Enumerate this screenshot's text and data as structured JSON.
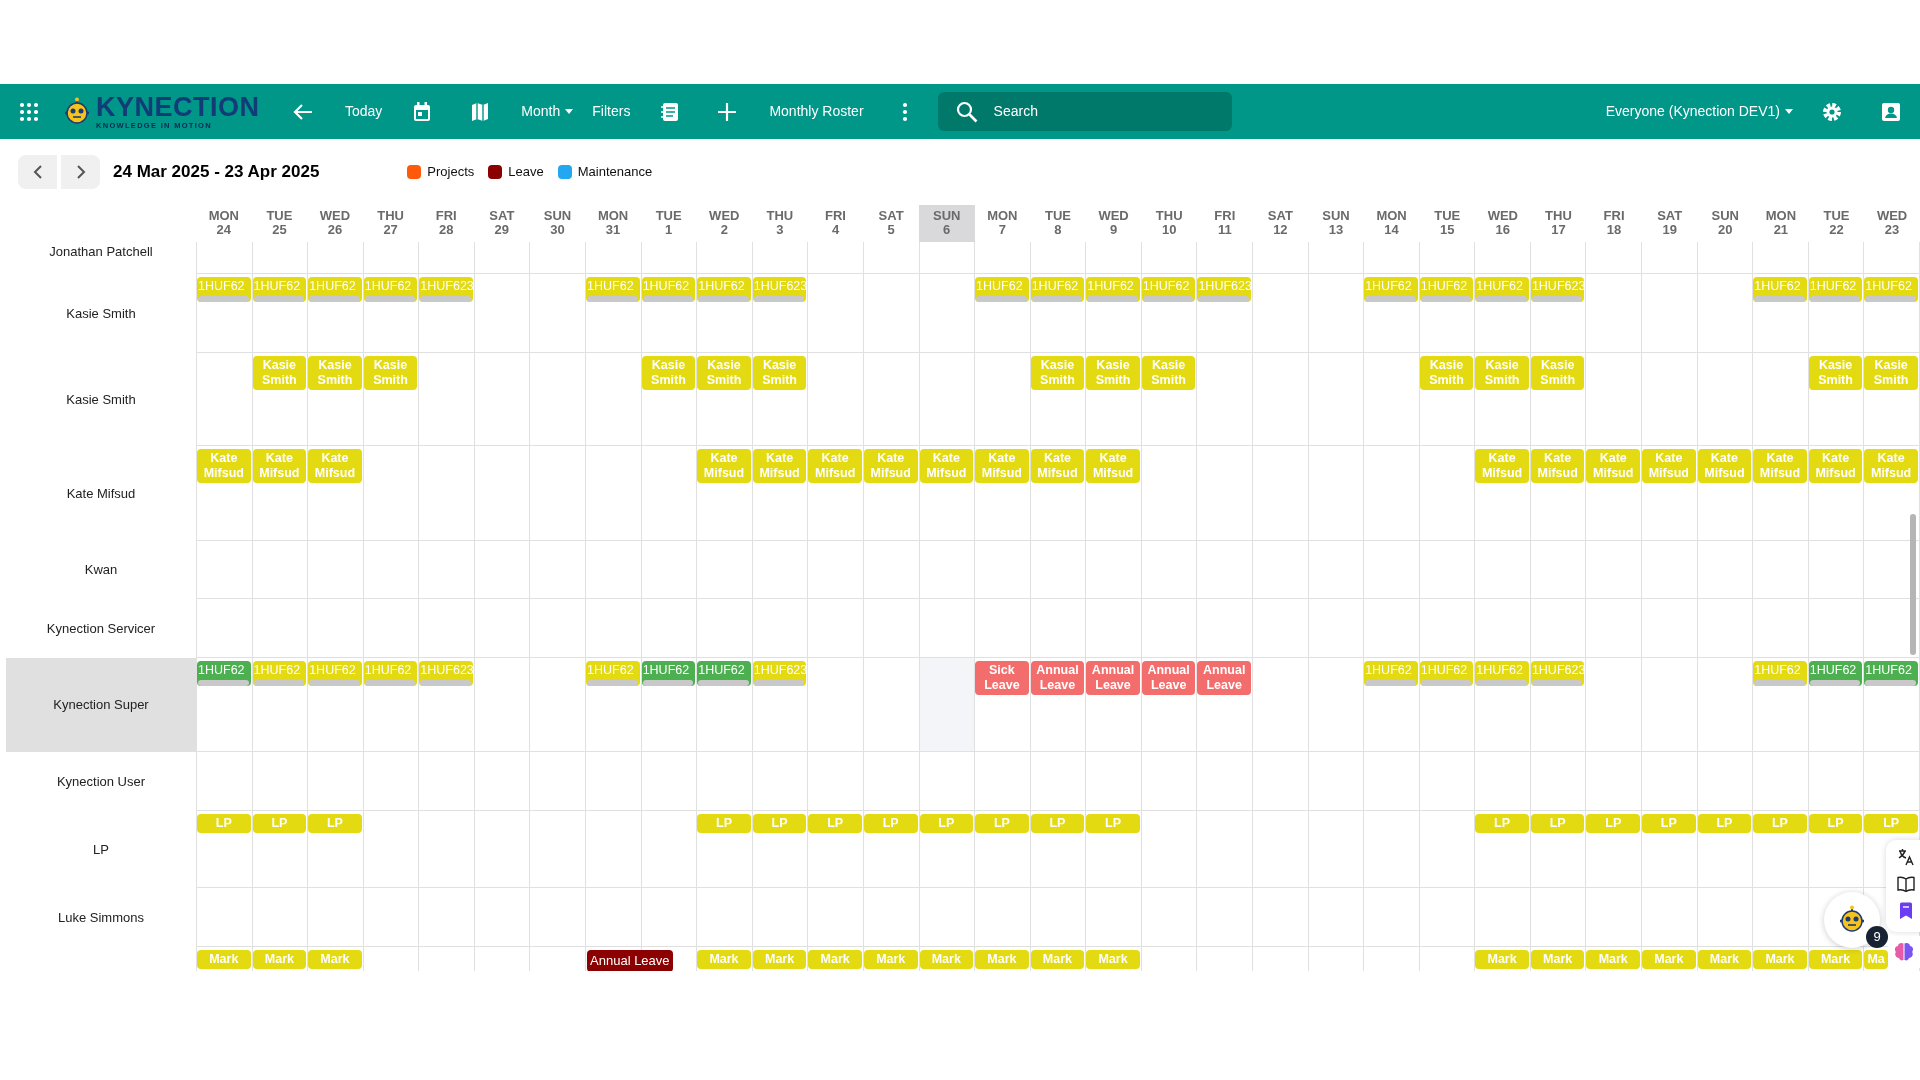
{
  "toolbar": {
    "logo": {
      "name": "KYNECTION",
      "tagline": "KNOWLEDGE IN MOTION"
    },
    "today": "Today",
    "view": "Month",
    "filters": "Filters",
    "roster": "Monthly Roster",
    "search": {
      "placeholder": "Search"
    },
    "scope": "Everyone (Kynection DEV1)"
  },
  "range": "24 Mar 2025 - 23 Apr 2025",
  "legend": [
    {
      "label": "Projects",
      "color": "#ff5a0a"
    },
    {
      "label": "Leave",
      "color": "#8b0000"
    },
    {
      "label": "Maintenance",
      "color": "#22a7f0"
    }
  ],
  "days": [
    {
      "dow": "MON",
      "date": "24",
      "selected": false
    },
    {
      "dow": "TUE",
      "date": "25",
      "selected": false
    },
    {
      "dow": "WED",
      "date": "26",
      "selected": false
    },
    {
      "dow": "THU",
      "date": "27",
      "selected": false
    },
    {
      "dow": "FRI",
      "date": "28",
      "selected": false
    },
    {
      "dow": "SAT",
      "date": "29",
      "selected": false
    },
    {
      "dow": "SUN",
      "date": "30",
      "selected": false
    },
    {
      "dow": "MON",
      "date": "31",
      "selected": false
    },
    {
      "dow": "TUE",
      "date": "1",
      "selected": false
    },
    {
      "dow": "WED",
      "date": "2",
      "selected": false
    },
    {
      "dow": "THU",
      "date": "3",
      "selected": false
    },
    {
      "dow": "FRI",
      "date": "4",
      "selected": false
    },
    {
      "dow": "SAT",
      "date": "5",
      "selected": false
    },
    {
      "dow": "SUN",
      "date": "6",
      "selected": true
    },
    {
      "dow": "MON",
      "date": "7",
      "selected": false
    },
    {
      "dow": "TUE",
      "date": "8",
      "selected": false
    },
    {
      "dow": "WED",
      "date": "9",
      "selected": false
    },
    {
      "dow": "THU",
      "date": "10",
      "selected": false
    },
    {
      "dow": "FRI",
      "date": "11",
      "selected": false
    },
    {
      "dow": "SAT",
      "date": "12",
      "selected": false
    },
    {
      "dow": "SUN",
      "date": "13",
      "selected": false
    },
    {
      "dow": "MON",
      "date": "14",
      "selected": false
    },
    {
      "dow": "TUE",
      "date": "15",
      "selected": false
    },
    {
      "dow": "WED",
      "date": "16",
      "selected": false
    },
    {
      "dow": "THU",
      "date": "17",
      "selected": false
    },
    {
      "dow": "FRI",
      "date": "18",
      "selected": false
    },
    {
      "dow": "SAT",
      "date": "19",
      "selected": false
    },
    {
      "dow": "SUN",
      "date": "20",
      "selected": false
    },
    {
      "dow": "MON",
      "date": "21",
      "selected": false
    },
    {
      "dow": "TUE",
      "date": "22",
      "selected": false
    },
    {
      "dow": "WED",
      "date": "23",
      "selected": false
    }
  ],
  "rows": [
    {
      "name": "Jonathan Patchell",
      "selected": false
    },
    {
      "name": "Kasie Smith",
      "selected": false,
      "cells": [
        {
          "kind": "task",
          "text": "1HUF62",
          "color": "#e3da12"
        },
        {
          "kind": "task",
          "text": "1HUF62",
          "color": "#e3da12"
        },
        {
          "kind": "task",
          "text": "1HUF62",
          "color": "#e3da12"
        },
        {
          "kind": "task",
          "text": "1HUF62",
          "color": "#e3da12"
        },
        {
          "kind": "task",
          "text": "1HUF623",
          "color": "#e3da12"
        },
        null,
        null,
        {
          "kind": "task",
          "text": "1HUF62",
          "color": "#e3da12"
        },
        {
          "kind": "task",
          "text": "1HUF62",
          "color": "#e3da12"
        },
        {
          "kind": "task",
          "text": "1HUF62",
          "color": "#e3da12"
        },
        {
          "kind": "task",
          "text": "1HUF623",
          "color": "#e3da12"
        },
        null,
        null,
        null,
        {
          "kind": "task",
          "text": "1HUF62",
          "color": "#e3da12"
        },
        {
          "kind": "task",
          "text": "1HUF62",
          "color": "#e3da12"
        },
        {
          "kind": "task",
          "text": "1HUF62",
          "color": "#e3da12"
        },
        {
          "kind": "task",
          "text": "1HUF62",
          "color": "#e3da12"
        },
        {
          "kind": "task",
          "text": "1HUF623",
          "color": "#e3da12"
        },
        null,
        null,
        {
          "kind": "task",
          "text": "1HUF62",
          "color": "#e3da12"
        },
        {
          "kind": "task",
          "text": "1HUF62",
          "color": "#e3da12"
        },
        {
          "kind": "task",
          "text": "1HUF62",
          "color": "#e3da12"
        },
        {
          "kind": "task",
          "text": "1HUF623",
          "color": "#e3da12"
        },
        null,
        null,
        null,
        {
          "kind": "task",
          "text": "1HUF62",
          "color": "#e3da12"
        },
        {
          "kind": "task",
          "text": "1HUF62",
          "color": "#e3da12"
        },
        {
          "kind": "task",
          "text": "1HUF62",
          "color": "#e3da12"
        }
      ]
    },
    {
      "name": "Kasie Smith",
      "selected": false,
      "cells": [
        null,
        {
          "kind": "chip",
          "text": "Kasie Smith",
          "color": "#e3da12"
        },
        {
          "kind": "chip",
          "text": "Kasie Smith",
          "color": "#e3da12"
        },
        {
          "kind": "chip",
          "text": "Kasie Smith",
          "color": "#e3da12"
        },
        null,
        null,
        null,
        null,
        {
          "kind": "chip",
          "text": "Kasie Smith",
          "color": "#e3da12"
        },
        {
          "kind": "chip",
          "text": "Kasie Smith",
          "color": "#e3da12"
        },
        {
          "kind": "chip",
          "text": "Kasie Smith",
          "color": "#e3da12"
        },
        null,
        null,
        null,
        null,
        {
          "kind": "chip",
          "text": "Kasie Smith",
          "color": "#e3da12"
        },
        {
          "kind": "chip",
          "text": "Kasie Smith",
          "color": "#e3da12"
        },
        {
          "kind": "chip",
          "text": "Kasie Smith",
          "color": "#e3da12"
        },
        null,
        null,
        null,
        null,
        {
          "kind": "chip",
          "text": "Kasie Smith",
          "color": "#e3da12"
        },
        {
          "kind": "chip",
          "text": "Kasie Smith",
          "color": "#e3da12"
        },
        {
          "kind": "chip",
          "text": "Kasie Smith",
          "color": "#e3da12"
        },
        null,
        null,
        null,
        null,
        {
          "kind": "chip",
          "text": "Kasie Smith",
          "color": "#e3da12"
        },
        {
          "kind": "chip",
          "text": "Kasie Smith",
          "color": "#e3da12"
        }
      ]
    },
    {
      "name": "Kate Mifsud",
      "selected": false,
      "cells": [
        {
          "kind": "chip",
          "text": "Kate Mifsud",
          "color": "#e3da12"
        },
        {
          "kind": "chip",
          "text": "Kate Mifsud",
          "color": "#e3da12"
        },
        {
          "kind": "chip",
          "text": "Kate Mifsud",
          "color": "#e3da12"
        },
        null,
        null,
        null,
        null,
        null,
        null,
        {
          "kind": "chip",
          "text": "Kate Mifsud",
          "color": "#e3da12"
        },
        {
          "kind": "chip",
          "text": "Kate Mifsud",
          "color": "#e3da12"
        },
        {
          "kind": "chip",
          "text": "Kate Mifsud",
          "color": "#e3da12"
        },
        {
          "kind": "chip",
          "text": "Kate Mifsud",
          "color": "#e3da12"
        },
        {
          "kind": "chip",
          "text": "Kate Mifsud",
          "color": "#e3da12"
        },
        {
          "kind": "chip",
          "text": "Kate Mifsud",
          "color": "#e3da12"
        },
        {
          "kind": "chip",
          "text": "Kate Mifsud",
          "color": "#e3da12"
        },
        {
          "kind": "chip",
          "text": "Kate Mifsud",
          "color": "#e3da12"
        },
        null,
        null,
        null,
        null,
        null,
        null,
        {
          "kind": "chip",
          "text": "Kate Mifsud",
          "color": "#e3da12"
        },
        {
          "kind": "chip",
          "text": "Kate Mifsud",
          "color": "#e3da12"
        },
        {
          "kind": "chip",
          "text": "Kate Mifsud",
          "color": "#e3da12"
        },
        {
          "kind": "chip",
          "text": "Kate Mifsud",
          "color": "#e3da12"
        },
        {
          "kind": "chip",
          "text": "Kate Mifsud",
          "color": "#e3da12"
        },
        {
          "kind": "chip",
          "text": "Kate Mifsud",
          "color": "#e3da12"
        },
        {
          "kind": "chip",
          "text": "Kate Mifsud",
          "color": "#e3da12"
        },
        {
          "kind": "chip",
          "text": "Kate Mifsud",
          "color": "#e3da12"
        }
      ]
    },
    {
      "name": "Kwan",
      "selected": false
    },
    {
      "name": "Kynection Servicer",
      "selected": false
    },
    {
      "name": "Kynection Super",
      "selected": true,
      "cells": [
        {
          "kind": "task",
          "text": "1HUF62",
          "color": "#4caf50"
        },
        {
          "kind": "task",
          "text": "1HUF62",
          "color": "#e3da12"
        },
        {
          "kind": "task",
          "text": "1HUF62",
          "color": "#e3da12"
        },
        {
          "kind": "task",
          "text": "1HUF62",
          "color": "#e3da12"
        },
        {
          "kind": "task",
          "text": "1HUF623",
          "color": "#e3da12"
        },
        null,
        null,
        {
          "kind": "task",
          "text": "1HUF62",
          "color": "#e3da12"
        },
        {
          "kind": "task",
          "text": "1HUF62",
          "color": "#4caf50"
        },
        {
          "kind": "task",
          "text": "1HUF62",
          "color": "#4caf50"
        },
        {
          "kind": "task",
          "text": "1HUF623",
          "color": "#e3da12"
        },
        null,
        null,
        null,
        {
          "kind": "chip",
          "text": "Sick Leave",
          "color": "#f46d6d"
        },
        {
          "kind": "chip",
          "text": "Annual Leave",
          "color": "#f46d6d"
        },
        {
          "kind": "chip",
          "text": "Annual Leave",
          "color": "#f46d6d"
        },
        {
          "kind": "chip",
          "text": "Annual Leave",
          "color": "#f46d6d"
        },
        {
          "kind": "chip",
          "text": "Annual Leave",
          "color": "#f46d6d"
        },
        null,
        null,
        {
          "kind": "task",
          "text": "1HUF62",
          "color": "#e3da12"
        },
        {
          "kind": "task",
          "text": "1HUF62",
          "color": "#e3da12"
        },
        {
          "kind": "task",
          "text": "1HUF62",
          "color": "#e3da12"
        },
        {
          "kind": "task",
          "text": "1HUF623",
          "color": "#e3da12"
        },
        null,
        null,
        null,
        {
          "kind": "task",
          "text": "1HUF62",
          "color": "#e3da12"
        },
        {
          "kind": "task",
          "text": "1HUF62",
          "color": "#4caf50"
        },
        {
          "kind": "task",
          "text": "1HUF62",
          "color": "#4caf50"
        }
      ]
    },
    {
      "name": "Kynection User",
      "selected": false
    },
    {
      "name": "LP",
      "selected": false,
      "cells": [
        {
          "kind": "chip",
          "text": "LP",
          "color": "#e3da12"
        },
        {
          "kind": "chip",
          "text": "LP",
          "color": "#e3da12"
        },
        {
          "kind": "chip",
          "text": "LP",
          "color": "#e3da12"
        },
        null,
        null,
        null,
        null,
        null,
        null,
        {
          "kind": "chip",
          "text": "LP",
          "color": "#e3da12"
        },
        {
          "kind": "chip",
          "text": "LP",
          "color": "#e3da12"
        },
        {
          "kind": "chip",
          "text": "LP",
          "color": "#e3da12"
        },
        {
          "kind": "chip",
          "text": "LP",
          "color": "#e3da12"
        },
        {
          "kind": "chip",
          "text": "LP",
          "color": "#e3da12"
        },
        {
          "kind": "chip",
          "text": "LP",
          "color": "#e3da12"
        },
        {
          "kind": "chip",
          "text": "LP",
          "color": "#e3da12"
        },
        {
          "kind": "chip",
          "text": "LP",
          "color": "#e3da12"
        },
        null,
        null,
        null,
        null,
        null,
        null,
        {
          "kind": "chip",
          "text": "LP",
          "color": "#e3da12"
        },
        {
          "kind": "chip",
          "text": "LP",
          "color": "#e3da12"
        },
        {
          "kind": "chip",
          "text": "LP",
          "color": "#e3da12"
        },
        {
          "kind": "chip",
          "text": "LP",
          "color": "#e3da12"
        },
        {
          "kind": "chip",
          "text": "LP",
          "color": "#e3da12"
        },
        {
          "kind": "chip",
          "text": "LP",
          "color": "#e3da12"
        },
        {
          "kind": "chip",
          "text": "LP",
          "color": "#e3da12"
        },
        {
          "kind": "chip",
          "text": "LP",
          "color": "#e3da12"
        }
      ]
    },
    {
      "name": "Luke Simmons",
      "selected": false
    },
    {
      "cells": [
        {
          "kind": "chip",
          "text": "Mark",
          "color": "#e3da12"
        },
        {
          "kind": "chip",
          "text": "Mark",
          "color": "#e3da12"
        },
        {
          "kind": "chip",
          "text": "Mark",
          "color": "#e3da12"
        },
        null,
        null,
        null,
        null,
        {
          "kind": "wide",
          "text": "Annual Leave",
          "color": "#8b0000"
        },
        null,
        {
          "kind": "chip",
          "text": "Mark",
          "color": "#e3da12"
        },
        {
          "kind": "chip",
          "text": "Mark",
          "color": "#e3da12"
        },
        {
          "kind": "chip",
          "text": "Mark",
          "color": "#e3da12"
        },
        {
          "kind": "chip",
          "text": "Mark",
          "color": "#e3da12"
        },
        {
          "kind": "chip",
          "text": "Mark",
          "color": "#e3da12"
        },
        {
          "kind": "chip",
          "text": "Mark",
          "color": "#e3da12"
        },
        {
          "kind": "chip",
          "text": "Mark",
          "color": "#e3da12"
        },
        {
          "kind": "chip",
          "text": "Mark",
          "color": "#e3da12"
        },
        null,
        null,
        null,
        null,
        null,
        null,
        {
          "kind": "chip",
          "text": "Mark",
          "color": "#e3da12"
        },
        {
          "kind": "chip",
          "text": "Mark",
          "color": "#e3da12"
        },
        {
          "kind": "chip",
          "text": "Mark",
          "color": "#e3da12"
        },
        {
          "kind": "chip",
          "text": "Mark",
          "color": "#e3da12"
        },
        {
          "kind": "chip",
          "text": "Mark",
          "color": "#e3da12"
        },
        {
          "kind": "chip",
          "text": "Mark",
          "color": "#e3da12"
        },
        {
          "kind": "chip",
          "text": "Mark",
          "color": "#e3da12"
        },
        {
          "kind": "chip",
          "text": "Ma",
          "color": "#e3da12"
        }
      ]
    }
  ],
  "widgets": {
    "badge": "9"
  }
}
